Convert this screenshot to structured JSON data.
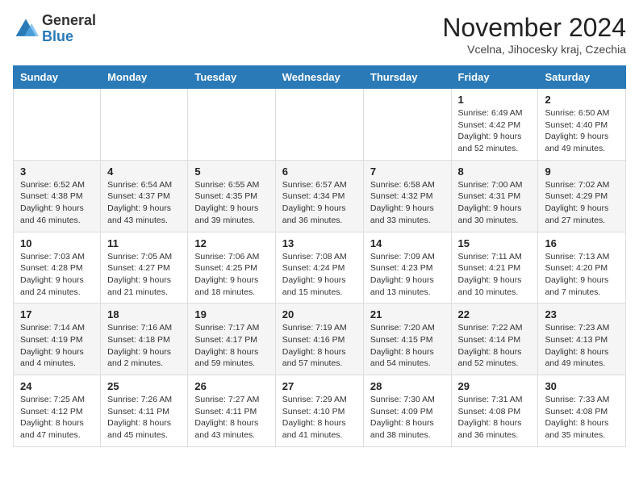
{
  "logo": {
    "general": "General",
    "blue": "Blue"
  },
  "title": "November 2024",
  "location": "Vcelna, Jihocesky kraj, Czechia",
  "days_header": [
    "Sunday",
    "Monday",
    "Tuesday",
    "Wednesday",
    "Thursday",
    "Friday",
    "Saturday"
  ],
  "weeks": [
    [
      {
        "num": "",
        "info": ""
      },
      {
        "num": "",
        "info": ""
      },
      {
        "num": "",
        "info": ""
      },
      {
        "num": "",
        "info": ""
      },
      {
        "num": "",
        "info": ""
      },
      {
        "num": "1",
        "info": "Sunrise: 6:49 AM\nSunset: 4:42 PM\nDaylight: 9 hours\nand 52 minutes."
      },
      {
        "num": "2",
        "info": "Sunrise: 6:50 AM\nSunset: 4:40 PM\nDaylight: 9 hours\nand 49 minutes."
      }
    ],
    [
      {
        "num": "3",
        "info": "Sunrise: 6:52 AM\nSunset: 4:38 PM\nDaylight: 9 hours\nand 46 minutes."
      },
      {
        "num": "4",
        "info": "Sunrise: 6:54 AM\nSunset: 4:37 PM\nDaylight: 9 hours\nand 43 minutes."
      },
      {
        "num": "5",
        "info": "Sunrise: 6:55 AM\nSunset: 4:35 PM\nDaylight: 9 hours\nand 39 minutes."
      },
      {
        "num": "6",
        "info": "Sunrise: 6:57 AM\nSunset: 4:34 PM\nDaylight: 9 hours\nand 36 minutes."
      },
      {
        "num": "7",
        "info": "Sunrise: 6:58 AM\nSunset: 4:32 PM\nDaylight: 9 hours\nand 33 minutes."
      },
      {
        "num": "8",
        "info": "Sunrise: 7:00 AM\nSunset: 4:31 PM\nDaylight: 9 hours\nand 30 minutes."
      },
      {
        "num": "9",
        "info": "Sunrise: 7:02 AM\nSunset: 4:29 PM\nDaylight: 9 hours\nand 27 minutes."
      }
    ],
    [
      {
        "num": "10",
        "info": "Sunrise: 7:03 AM\nSunset: 4:28 PM\nDaylight: 9 hours\nand 24 minutes."
      },
      {
        "num": "11",
        "info": "Sunrise: 7:05 AM\nSunset: 4:27 PM\nDaylight: 9 hours\nand 21 minutes."
      },
      {
        "num": "12",
        "info": "Sunrise: 7:06 AM\nSunset: 4:25 PM\nDaylight: 9 hours\nand 18 minutes."
      },
      {
        "num": "13",
        "info": "Sunrise: 7:08 AM\nSunset: 4:24 PM\nDaylight: 9 hours\nand 15 minutes."
      },
      {
        "num": "14",
        "info": "Sunrise: 7:09 AM\nSunset: 4:23 PM\nDaylight: 9 hours\nand 13 minutes."
      },
      {
        "num": "15",
        "info": "Sunrise: 7:11 AM\nSunset: 4:21 PM\nDaylight: 9 hours\nand 10 minutes."
      },
      {
        "num": "16",
        "info": "Sunrise: 7:13 AM\nSunset: 4:20 PM\nDaylight: 9 hours\nand 7 minutes."
      }
    ],
    [
      {
        "num": "17",
        "info": "Sunrise: 7:14 AM\nSunset: 4:19 PM\nDaylight: 9 hours\nand 4 minutes."
      },
      {
        "num": "18",
        "info": "Sunrise: 7:16 AM\nSunset: 4:18 PM\nDaylight: 9 hours\nand 2 minutes."
      },
      {
        "num": "19",
        "info": "Sunrise: 7:17 AM\nSunset: 4:17 PM\nDaylight: 8 hours\nand 59 minutes."
      },
      {
        "num": "20",
        "info": "Sunrise: 7:19 AM\nSunset: 4:16 PM\nDaylight: 8 hours\nand 57 minutes."
      },
      {
        "num": "21",
        "info": "Sunrise: 7:20 AM\nSunset: 4:15 PM\nDaylight: 8 hours\nand 54 minutes."
      },
      {
        "num": "22",
        "info": "Sunrise: 7:22 AM\nSunset: 4:14 PM\nDaylight: 8 hours\nand 52 minutes."
      },
      {
        "num": "23",
        "info": "Sunrise: 7:23 AM\nSunset: 4:13 PM\nDaylight: 8 hours\nand 49 minutes."
      }
    ],
    [
      {
        "num": "24",
        "info": "Sunrise: 7:25 AM\nSunset: 4:12 PM\nDaylight: 8 hours\nand 47 minutes."
      },
      {
        "num": "25",
        "info": "Sunrise: 7:26 AM\nSunset: 4:11 PM\nDaylight: 8 hours\nand 45 minutes."
      },
      {
        "num": "26",
        "info": "Sunrise: 7:27 AM\nSunset: 4:11 PM\nDaylight: 8 hours\nand 43 minutes."
      },
      {
        "num": "27",
        "info": "Sunrise: 7:29 AM\nSunset: 4:10 PM\nDaylight: 8 hours\nand 41 minutes."
      },
      {
        "num": "28",
        "info": "Sunrise: 7:30 AM\nSunset: 4:09 PM\nDaylight: 8 hours\nand 38 minutes."
      },
      {
        "num": "29",
        "info": "Sunrise: 7:31 AM\nSunset: 4:08 PM\nDaylight: 8 hours\nand 36 minutes."
      },
      {
        "num": "30",
        "info": "Sunrise: 7:33 AM\nSunset: 4:08 PM\nDaylight: 8 hours\nand 35 minutes."
      }
    ]
  ]
}
